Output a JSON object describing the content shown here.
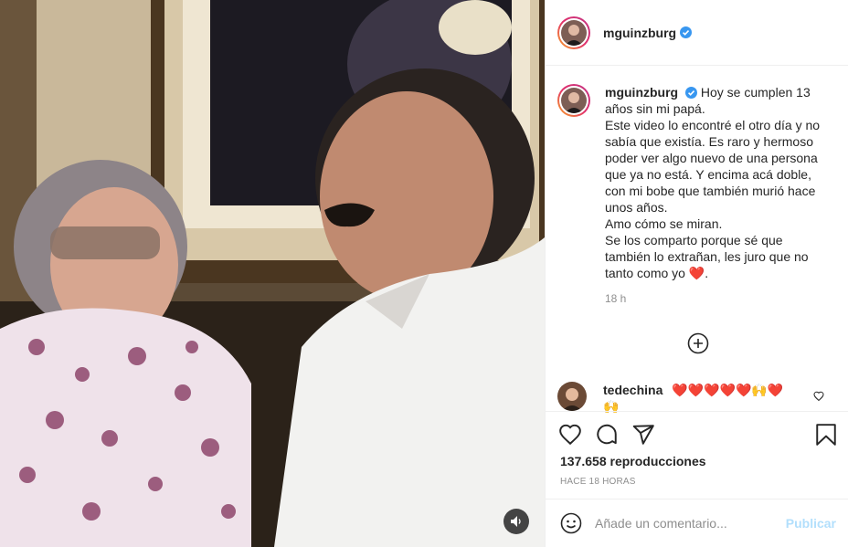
{
  "post": {
    "username": "mguinzburg",
    "verified": true,
    "caption_lines": [
      "Hoy se cumplen 13",
      "años sin mi papá.",
      "Este video lo encontré el otro día y no",
      "sabía que existía. Es raro y hermoso",
      "poder ver algo nuevo de una persona",
      "que ya no está. Y encima acá doble,",
      "con mi bobe que también murió hace",
      "unos años.",
      "Amo cómo se miran.",
      "Se los comparto porque sé que",
      "también lo extrañan, les juro que no",
      "tanto como yo ❤️."
    ],
    "caption_time": "18 h",
    "views": "137.658 reproducciones",
    "posted_ago": "HACE 18 HORAS"
  },
  "comments": [
    {
      "username": "tedechina",
      "text": "❤️❤️❤️❤️❤️🙌❤️",
      "text_line2": "🙌"
    }
  ],
  "comment_box": {
    "placeholder": "Añade un comentario...",
    "publish_label": "Publicar"
  },
  "icons": {
    "like": "heart-icon",
    "comment": "comment-bubble-icon",
    "share": "paper-plane-icon",
    "save": "bookmark-icon",
    "emoji": "smiley-icon",
    "mute": "speaker-icon",
    "load_more": "plus-circle-icon",
    "comment_like": "heart-small-icon"
  },
  "colors": {
    "verified_blue": "#3897f0",
    "publish_disabled": "#b2dffc",
    "muted_text": "#8e8e8e",
    "border": "#efefef"
  }
}
